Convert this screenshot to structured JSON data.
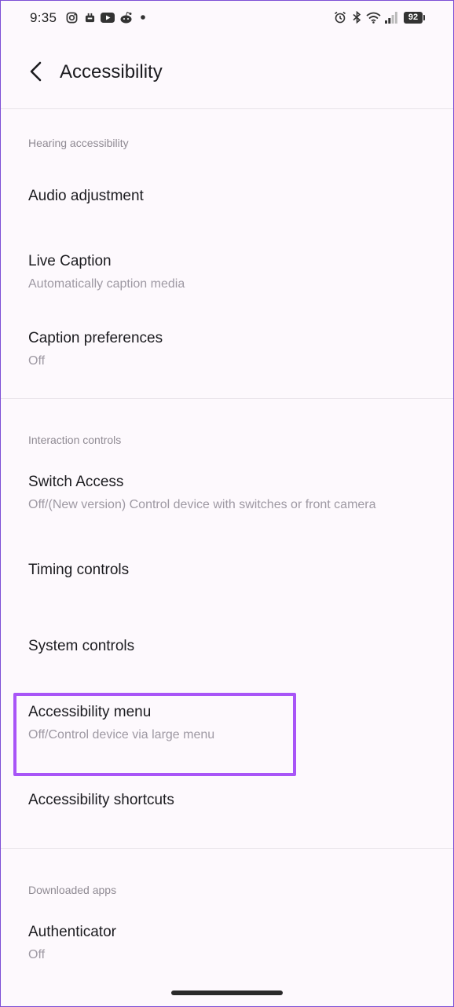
{
  "status_bar": {
    "time": "9:35",
    "left_icons": [
      "instagram-icon",
      "notification-app-icon",
      "youtube-icon",
      "reddit-icon",
      "dot-icon"
    ],
    "right_icons": [
      "alarm-icon",
      "bluetooth-icon",
      "wifi-icon",
      "signal-icon"
    ],
    "battery": "92"
  },
  "header": {
    "title": "Accessibility"
  },
  "sections": {
    "hearing": {
      "label": "Hearing accessibility",
      "items": [
        {
          "title": "Audio adjustment"
        },
        {
          "title": "Live Caption",
          "subtitle": "Automatically caption media"
        },
        {
          "title": "Caption preferences",
          "subtitle": "Off"
        }
      ]
    },
    "interaction": {
      "label": "Interaction controls",
      "items": [
        {
          "title": "Switch Access",
          "subtitle": "Off/(New version) Control device with switches or front camera"
        },
        {
          "title": "Timing controls"
        },
        {
          "title": "System controls"
        },
        {
          "title": "Accessibility menu",
          "subtitle": "Off/Control device via large menu"
        },
        {
          "title": "Accessibility shortcuts"
        }
      ]
    },
    "downloaded": {
      "label": "Downloaded apps",
      "items": [
        {
          "title": "Authenticator",
          "subtitle": "Off"
        }
      ]
    }
  },
  "colors": {
    "highlight": "#a855f7",
    "background": "#fdf9fd"
  }
}
